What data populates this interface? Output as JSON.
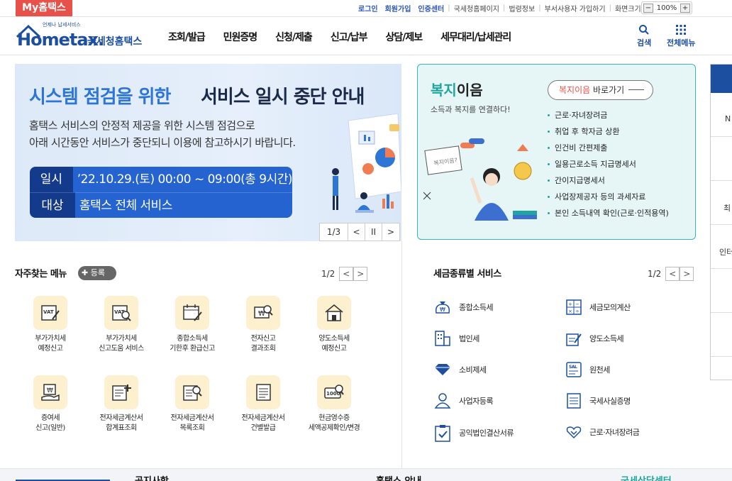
{
  "topbar": {
    "my_label": "My홈택스",
    "links": [
      "로그인",
      "회원가입",
      "인증센터",
      "국세청홈페이지",
      "법령정보",
      "부서사용자 가입하기",
      "화면크기"
    ],
    "zoom": "100%"
  },
  "header": {
    "logo_tag": "언제나 납세서비스",
    "logo_home": "Hometax.",
    "logo_kor": "국세청홈택스",
    "gnb": [
      "조회/발급",
      "민원증명",
      "신청/제출",
      "신고/납부",
      "상담/제보",
      "세무대리/납세관리"
    ],
    "search_label": "검색",
    "allmenu_label": "전체메뉴"
  },
  "hero": {
    "title_a": "시스템 점검을 위한",
    "title_b": "서비스 일시 중단 안내",
    "desc_1": "홈택스 서비스의 안정적 제공을 위한 시스템 점검으로",
    "desc_2": "아래 시간동안 서비스가 중단되니 이용에 참고하시기 바랍니다.",
    "row1_key": "일시",
    "row1_val": "’22.10.29.(토) 00:00 ~ 09:00(총 9시간)",
    "row2_key": "대상",
    "row2_val": "홈택스 전체 서비스",
    "pager": "1/3",
    "pager_prev": "<",
    "pager_pause": "II",
    "pager_next": ">"
  },
  "welfare": {
    "title_green": "복지",
    "title_rest": "이음",
    "sub": "소득과 복지를 연결하다!",
    "btn_red": "복지이음",
    "btn_rest": " 바로가기",
    "bubble": "복지이음?",
    "items": [
      "근로·자녀장려금",
      "취업 후 학자금 상환",
      "인건비 간편제출",
      "일용근로소득 지급명세서",
      "간이지급명세서",
      "사업장제공자 등의 과세자료",
      "본인 소득내역 확인(근로·인적용역)"
    ]
  },
  "rpanel": {
    "cells": [
      "",
      "N",
      "",
      "최",
      "인터",
      "",
      ""
    ]
  },
  "favorites": {
    "title": "자주찾는 메뉴",
    "register": "등록",
    "page": "1/2",
    "prev": "<",
    "next": ">",
    "items": [
      {
        "l1": "부가가치세",
        "l2": "예정신고",
        "icon": "vat-pencil-icon"
      },
      {
        "l1": "부가가치세",
        "l2": "신고도움 서비스",
        "icon": "vat-search-icon"
      },
      {
        "l1": "종합소득세",
        "l2": "기한후 환급신고",
        "icon": "calendar-pencil-icon"
      },
      {
        "l1": "전자신고",
        "l2": "결과조회",
        "icon": "won-search-icon"
      },
      {
        "l1": "양도소득세",
        "l2": "예정신고",
        "icon": "house-icon"
      },
      {
        "l1": "증여세",
        "l2": "신고(일반)",
        "icon": "hand-won-icon"
      },
      {
        "l1": "전자세금계산서",
        "l2": "합계표조회",
        "icon": "invoice-plus-icon"
      },
      {
        "l1": "전자세금계산서",
        "l2": "목록조회",
        "icon": "invoice-search-icon"
      },
      {
        "l1": "전자세금계산서",
        "l2": "건별발급",
        "icon": "invoice-list-icon"
      },
      {
        "l1": "현금영수증",
        "l2": "세액공제확인/변경",
        "icon": "receipt-1000-icon"
      }
    ]
  },
  "taxtypes": {
    "title": "세금종류별 서비스",
    "page": "1/2",
    "prev": "<",
    "next": ">",
    "items": [
      {
        "label": "종합소득세",
        "icon": "moneybag-icon"
      },
      {
        "label": "세금모의계산",
        "icon": "calculator-icon"
      },
      {
        "label": "법인세",
        "icon": "building-icon"
      },
      {
        "label": "양도소득세",
        "icon": "document-pencil-icon"
      },
      {
        "label": "소비제세",
        "icon": "diamond-icon"
      },
      {
        "label": "원천세",
        "icon": "salary-icon"
      },
      {
        "label": "사업자등록",
        "icon": "person-icon"
      },
      {
        "label": "국세사실증명",
        "icon": "certificate-icon"
      },
      {
        "label": "공익법인결산서류",
        "icon": "clipboard-check-icon"
      },
      {
        "label": "근로·자녀장려금",
        "icon": "heart-hands-icon"
      }
    ]
  },
  "bottom": {
    "notice": "공지사항",
    "news": "홈택스 안내",
    "center": "국세상담센터"
  }
}
